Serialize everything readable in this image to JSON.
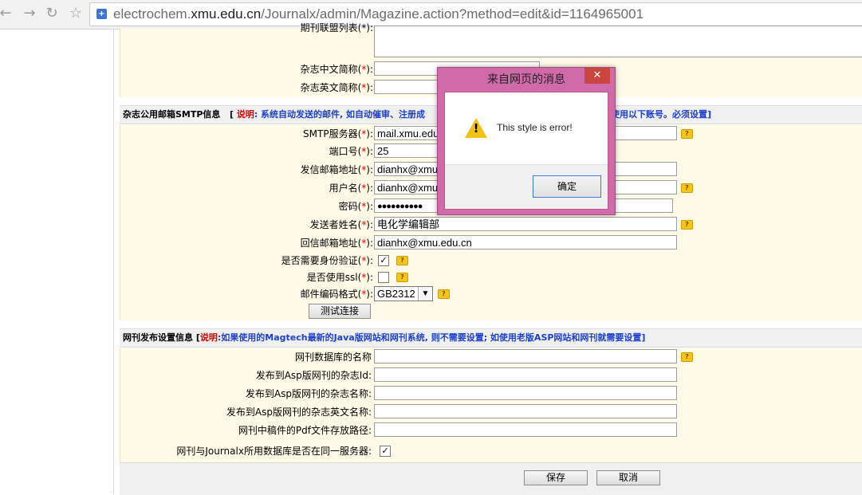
{
  "browser": {
    "url_prefix": "electrochem.",
    "url_host": "xmu.edu.cn",
    "url_path": "/Journalx/admin/Magazine.action?method=edit&id=1164965001"
  },
  "top_fields": {
    "partial_label": "期刊联盟列表(*):",
    "cn_abbr_label": "杂志中文简称(",
    "en_abbr_label": "杂志英文简称(",
    "star": "*",
    "close_paren": "):"
  },
  "smtp_section": {
    "title": "杂志公用邮箱SMTP信息",
    "note_open": "[",
    "note_label": "说明",
    "note_text_left": ": 系统自动发送的邮件, 如自动催审、注册成",
    "note_text_right": "使用以下账号。必须设置]",
    "smtp_server_label": "SMTP服务器(",
    "smtp_server_value": "mail.xmu.edu",
    "port_label": "端口号(",
    "port_value": "25",
    "sender_email_label": "发信邮箱地址(",
    "sender_email_value": "dianhx@xmu",
    "username_label": "用户名(",
    "username_value": "dianhx@xmu",
    "password_label": "密码(",
    "password_value": "●●●●●●●●●●",
    "sender_name_label": "发送者姓名(",
    "sender_name_value": "电化学编辑部",
    "reply_email_label": "回信邮箱地址(",
    "reply_email_value": "dianhx@xmu.edu.cn",
    "auth_label": "是否需要身份验证(",
    "auth_checked": "✓",
    "ssl_label": "是否使用ssl(",
    "encoding_label": "邮件编码格式(",
    "encoding_value": "GB2312",
    "test_button": "测试连接"
  },
  "publish_section": {
    "title": "网刊发布设置信息",
    "note_open": "[",
    "note_label": "说明",
    "note_text": ":如果使用的Magtech最新的Java版网站和网刊系统, 则不需要设置; 如使用老版ASP网站和网刊就需要设置]",
    "db_name_label": "网刊数据库的名称",
    "asp_id_label": "发布到Asp版网刊的杂志Id:",
    "asp_name_label": "发布到Asp版网刊的杂志名称:",
    "asp_en_name_label": "发布到Asp版网刊的杂志英文名称:",
    "pdf_path_label": "网刊中稿件的Pdf文件存放路径:",
    "same_server_label": "网刊与Journalx所用数据库是否在同一服务器:",
    "same_server_checked": "✓"
  },
  "actions": {
    "save": "保存",
    "cancel": "取消"
  },
  "dialog": {
    "title": "来自网页的消息",
    "close": "✕",
    "message": "This style is error!",
    "warn_mark": "!",
    "ok": "确定"
  },
  "help_icon_glyph": "?"
}
